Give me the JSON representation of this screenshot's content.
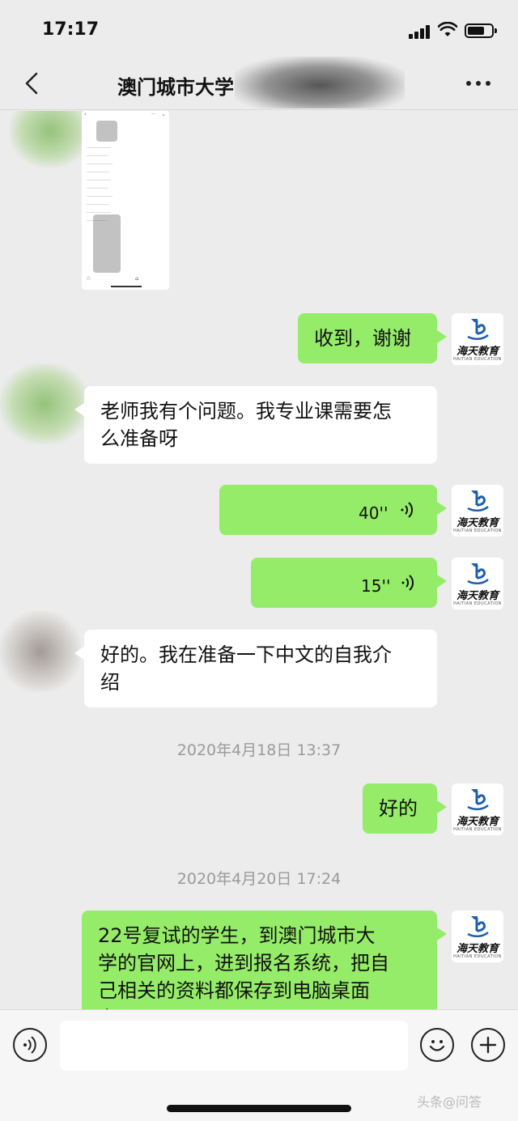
{
  "status_bar": {
    "time": "17:17"
  },
  "header": {
    "title": "澳门城市大学"
  },
  "messages": [
    {
      "text": "收到，谢谢"
    },
    {
      "text_line1": "老师我有个问题。我专业课需要怎",
      "text_line2": "么准备呀"
    },
    {
      "duration": "40''"
    },
    {
      "duration": "15''"
    },
    {
      "text_line1": "好的。我在准备一下中文的自我介",
      "text_line2": "绍"
    },
    {
      "text": "好的"
    },
    {
      "line1": "22号复试的学生，到澳门城市大",
      "line2": "学的官网上，进到报名系统，把自",
      "line3": "己相关的资料都保存到电脑桌面",
      "line4": "上"
    }
  ],
  "timestamps": [
    "2020年4月18日 13:37",
    "2020年4月20日 17:24"
  ],
  "avatar": {
    "brand_name": "海天教育",
    "brand_sub": "HAITIAN EDUCATION",
    "brand_color": "#1e5fae"
  },
  "input": {
    "placeholder": ""
  },
  "watermark": "头条@问答",
  "colors": {
    "outgoing_bubble": "#95ec69",
    "incoming_bubble": "#ffffff",
    "background": "#ececec"
  },
  "icons": [
    "back-icon",
    "more-icon",
    "voice-icon",
    "emoji-icon",
    "plus-icon",
    "signal-icon",
    "wifi-icon",
    "battery-icon"
  ]
}
